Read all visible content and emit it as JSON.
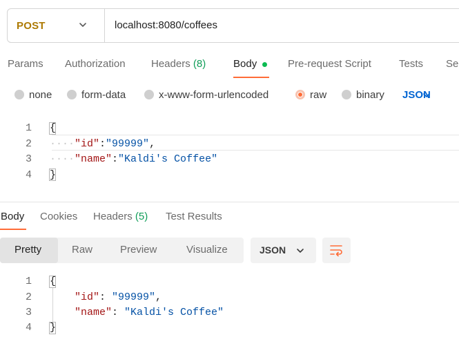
{
  "request": {
    "method": "POST",
    "url": "localhost:8080/coffees"
  },
  "request_tabs": {
    "params": "Params",
    "authorization": "Authorization",
    "headers": "Headers",
    "headers_count": "(8)",
    "body": "Body",
    "prerequest": "Pre-request Script",
    "tests": "Tests",
    "settings": "Se"
  },
  "body_types": {
    "none": "none",
    "form_data": "form-data",
    "urlencoded": "x-www-form-urlencoded",
    "raw": "raw",
    "binary": "binary",
    "selected": "raw",
    "format": "JSON"
  },
  "request_editor": {
    "line_numbers": [
      "1",
      "2",
      "3",
      "4"
    ],
    "open_brace": "{",
    "close_brace": "}",
    "id_key": "\"id\"",
    "id_colon": ":",
    "id_value": "\"99999\"",
    "id_comma": ",",
    "name_key": "\"name\"",
    "name_colon": ":",
    "name_value": "\"Kaldi's Coffee\""
  },
  "response_tabs": {
    "body": "Body",
    "cookies": "Cookies",
    "headers": "Headers",
    "headers_count": "(5)",
    "test_results": "Test Results"
  },
  "response_toolbar": {
    "pretty": "Pretty",
    "raw": "Raw",
    "preview": "Preview",
    "visualize": "Visualize",
    "format": "JSON",
    "active_view": "Pretty"
  },
  "response_editor": {
    "line_numbers": [
      "1",
      "2",
      "3",
      "4"
    ],
    "open_brace": "{",
    "close_brace": "}",
    "id_key": "\"id\"",
    "id_colon": ": ",
    "id_value": "\"99999\"",
    "id_comma": ",",
    "name_key": "\"name\"",
    "name_colon": ": ",
    "name_value": "\"Kaldi's Coffee\""
  },
  "colors": {
    "accent": "#ff6c37",
    "method_post": "#ad7a03",
    "count_green": "#0f9d58",
    "link_blue": "#0265d2",
    "json_key": "#a31515",
    "json_string": "#0451a5"
  },
  "icons": {
    "method_dropdown": "chevron-down-icon",
    "format_dropdown": "chevron-down-icon",
    "wrap": "wrap-lines-icon",
    "body_indicator": "green-dot-icon"
  }
}
